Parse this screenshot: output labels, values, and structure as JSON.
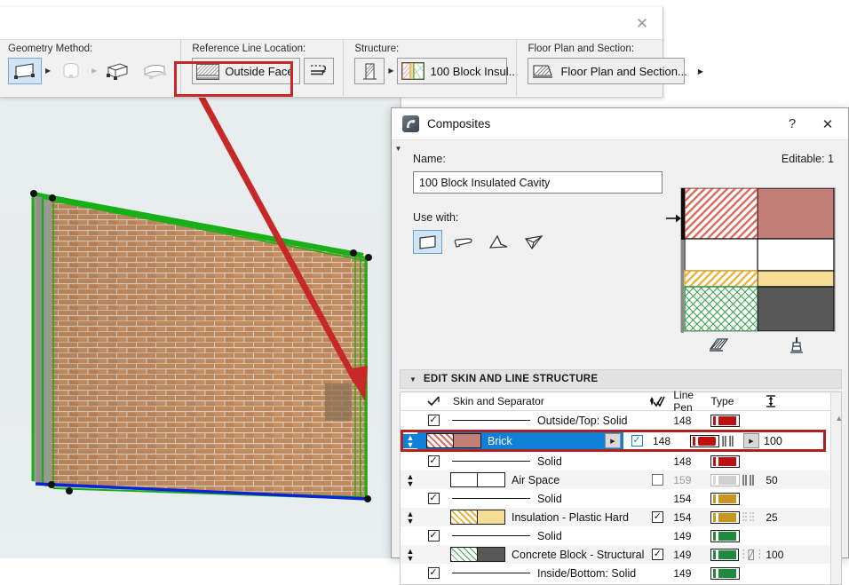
{
  "viewport": {
    "name": "3d-wall-view",
    "background_color": "#e6ebed",
    "wall_material": "brick",
    "selection_edge_color": "#16b016",
    "reference_line_color": "#0b23d8",
    "annotation_arrow_color": "#c62828"
  },
  "toolbar": {
    "close_label": "✕",
    "groups": [
      {
        "label": "Geometry Method:",
        "items": [
          {
            "name": "straight-wall-icon",
            "selected": true
          },
          {
            "name": "curved-wall-icon",
            "selected": false,
            "disabled": true
          },
          {
            "name": "rectangular-wall-icon",
            "selected": false
          },
          {
            "name": "trapezoid-wall-icon",
            "selected": false
          }
        ]
      },
      {
        "label": "Reference Line Location:",
        "value": "Outside Face",
        "highlighted": true,
        "flip_button_name": "flip-reference-line-button"
      },
      {
        "label": "Structure:",
        "structure_type_name": "composite-structure-icon",
        "value": "100 Block Insul..."
      },
      {
        "label": "Floor Plan and Section:",
        "value": "Floor Plan and Section..."
      }
    ]
  },
  "dialog": {
    "title": "Composites",
    "help_label": "?",
    "close_label": "✕",
    "name_label": "Name:",
    "name_value": "100 Block Insulated Cavity",
    "editable_label": "Editable: 1",
    "use_with_label": "Use with:",
    "use_with_items": [
      {
        "name": "wall-use-icon",
        "selected": true
      },
      {
        "name": "slab-use-icon",
        "selected": false
      },
      {
        "name": "roof-use-icon",
        "selected": false
      },
      {
        "name": "shell-use-icon",
        "selected": false
      }
    ],
    "preview": {
      "name": "composite-preview",
      "skins": [
        {
          "label": "Brick",
          "fill_color": "#c27f78",
          "hatch_color": "#d34b3c",
          "hatch": "diagonal",
          "height_pct": 35.5
        },
        {
          "label": "Air Space",
          "fill_color": "#ffffff",
          "hatch_color": "#111111",
          "hatch": "none",
          "height_pct": 22.5
        },
        {
          "label": "Insulation - Plastic Hard",
          "fill_color": "#f6dd95",
          "hatch_color": "#d9a227",
          "hatch": "diagonal",
          "height_pct": 11
        },
        {
          "label": "Concrete Block - Structural",
          "fill_color": "#585858",
          "hatch_color": "#1f8a3c",
          "hatch": "crosshatch",
          "height_pct": 31
        }
      ],
      "tools": [
        {
          "name": "hatch-preview-icon"
        },
        {
          "name": "paint-brush-icon"
        }
      ]
    },
    "skin_section": {
      "header": "EDIT SKIN AND LINE STRUCTURE",
      "expanded": true,
      "columns": [
        {
          "name": "use-checkbox-header",
          "label": ""
        },
        {
          "name": "skin-and-separator-header",
          "label": "Skin and Separator"
        },
        {
          "name": "core-checkbox-header",
          "label": ""
        },
        {
          "name": "line-pen-header",
          "label": "Line Pen"
        },
        {
          "name": "type-header",
          "label": "Type"
        },
        {
          "name": "thickness-header",
          "label": ""
        }
      ],
      "rows": [
        {
          "kind": "separator",
          "checked": true,
          "label": "Outside/Top: Solid",
          "pen": "148",
          "pen_color": "#bb1111",
          "type": "",
          "thickness": ""
        },
        {
          "kind": "skin",
          "selected": true,
          "label": "Brick",
          "core_checked": true,
          "pen": "148",
          "pen_color": "#bb1111",
          "type": "",
          "thickness": "100",
          "swatch_hatch_color": "#d34b3c",
          "swatch_fill_color": "#c27f78"
        },
        {
          "kind": "separator",
          "checked": true,
          "label": "Solid",
          "pen": "148",
          "pen_color": "#bb1111",
          "type": "",
          "thickness": ""
        },
        {
          "kind": "skin",
          "selected": false,
          "label": "Air Space",
          "core_checked": false,
          "pen": "159",
          "pen_color": "#cfcfcf",
          "type": "",
          "thickness": "50",
          "swatch_hatch_color": "#ffffff",
          "swatch_fill_color": "#ffffff"
        },
        {
          "kind": "separator",
          "checked": true,
          "label": "Solid",
          "pen": "154",
          "pen_color": "#c9951d",
          "type": "",
          "thickness": ""
        },
        {
          "kind": "skin",
          "selected": false,
          "label": "Insulation - Plastic Hard",
          "core_checked": true,
          "pen": "154",
          "pen_color": "#c9951d",
          "type": "",
          "thickness": "25",
          "swatch_hatch_color": "#d9a227",
          "swatch_fill_color": "#f6dd95"
        },
        {
          "kind": "separator",
          "checked": true,
          "label": "Solid",
          "pen": "149",
          "pen_color": "#1f8a3c",
          "type": "",
          "thickness": ""
        },
        {
          "kind": "skin",
          "selected": false,
          "label": "Concrete Block - Structural",
          "core_checked": true,
          "pen": "149",
          "pen_color": "#1f8a3c",
          "type": "",
          "thickness": "100",
          "swatch_hatch_color": "#1f8a3c",
          "swatch_fill_color": "#585858"
        },
        {
          "kind": "separator",
          "checked": true,
          "label": "Inside/Bottom: Solid",
          "pen": "149",
          "pen_color": "#1f8a3c",
          "type": "",
          "thickness": ""
        }
      ]
    }
  }
}
